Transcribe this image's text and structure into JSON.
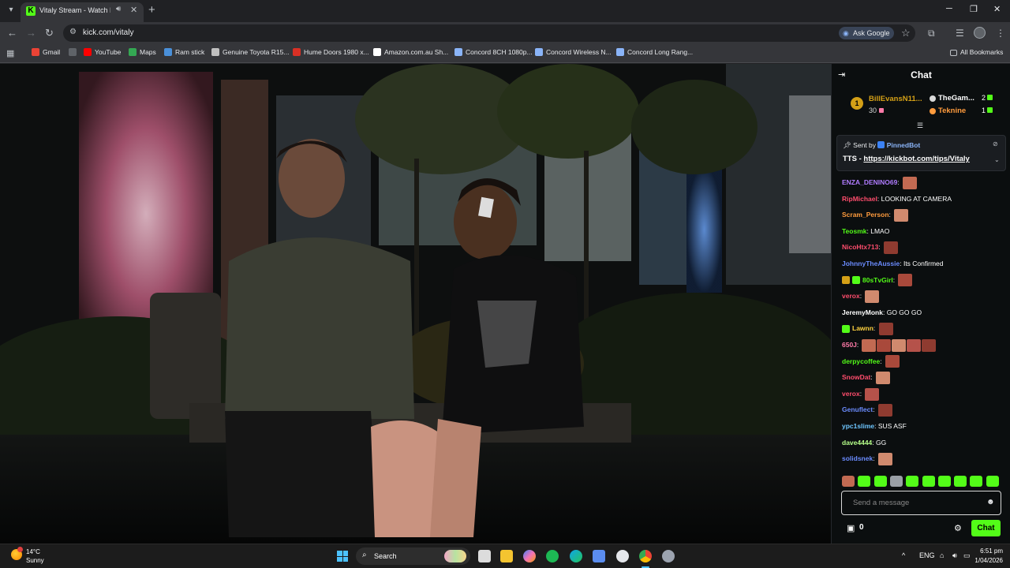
{
  "browser": {
    "tab": {
      "title": "Vitaly Stream - Watch Live o",
      "favicon": "K"
    },
    "url": "kick.com/vitaly",
    "ask_google": "Ask Google",
    "bookmarks": [
      {
        "label": "Gmail",
        "color": "#ea4335"
      },
      {
        "label": "",
        "color": "#5f6368"
      },
      {
        "label": "YouTube",
        "color": "#ff0000"
      },
      {
        "label": "Maps",
        "color": "#34a853"
      },
      {
        "label": "Ram stick",
        "color": "#4a90d9"
      },
      {
        "label": "Genuine Toyota R15...",
        "color": "#c0c0c0"
      },
      {
        "label": "Hume Doors 1980 x...",
        "color": "#d93025"
      },
      {
        "label": "Amazon.com.au Sh...",
        "color": "#ffffff"
      },
      {
        "label": "Concord 8CH 1080p...",
        "color": "#8ab4f8"
      },
      {
        "label": "Concord Wireless N...",
        "color": "#8ab4f8"
      },
      {
        "label": "Concord Long Rang...",
        "color": "#8ab4f8"
      }
    ],
    "all_bookmarks": "All Bookmarks"
  },
  "chat": {
    "title": "Chat",
    "leaderboard": [
      {
        "rank": "1",
        "name": "BillEvansN11...",
        "count": "30"
      },
      {
        "name": "TheGam...",
        "count": "2"
      },
      {
        "name": "Teknine",
        "count": "1"
      }
    ],
    "pinned": {
      "sent_by_label": "Sent by",
      "bot": "PinnedBot",
      "prefix": "TTS - ",
      "link": "https://kickbot.com/tips/Vitaly"
    },
    "messages": [
      {
        "user": "ENZA_DENINO69",
        "color": "#b07cff",
        "text": "",
        "emotes": 1
      },
      {
        "user": "RipMichael",
        "color": "#ff4d6d",
        "text": "LOOKING AT CAMERA",
        "emotes": 0
      },
      {
        "user": "Scram_Person",
        "color": "#ff9b3d",
        "text": "",
        "emotes": 1
      },
      {
        "user": "Teosmk",
        "color": "#53fc18",
        "text": "LMAO",
        "emotes": 0
      },
      {
        "user": "NicoHtx713",
        "color": "#ff4d6d",
        "text": "",
        "emotes": 1
      },
      {
        "user": "JohnnyTheAussie",
        "color": "#6b8cff",
        "text": "Its Confirmed",
        "emotes": 0
      },
      {
        "user": "80sTvGirl",
        "color": "#53fc18",
        "text": "",
        "emotes": 1,
        "badges": 2
      },
      {
        "user": "verox",
        "color": "#ff4d6d",
        "text": "",
        "emotes": 1
      },
      {
        "user": "JeremyMonk",
        "color": "#ffffff",
        "text": "GO GO GO",
        "emotes": 0
      },
      {
        "user": "Lawnn",
        "color": "#ffd23f",
        "text": "",
        "emotes": 1,
        "badges": 1
      },
      {
        "user": "650J",
        "color": "#ff7aa8",
        "text": "",
        "emotes": 5
      },
      {
        "user": "derpycoffee",
        "color": "#53fc18",
        "text": "",
        "emotes": 1
      },
      {
        "user": "SnowDat",
        "color": "#ff4d6d",
        "text": "",
        "emotes": 1
      },
      {
        "user": "verox",
        "color": "#ff4d6d",
        "text": "",
        "emotes": 1
      },
      {
        "user": "Genuflect",
        "color": "#6b8cff",
        "text": "",
        "emotes": 1
      },
      {
        "user": "ypc1slime",
        "color": "#6ec6ff",
        "text": "SUS ASF",
        "emotes": 0
      },
      {
        "user": "dave4444",
        "color": "#b6ff8a",
        "text": "GG",
        "emotes": 0
      },
      {
        "user": "solidsnek",
        "color": "#6b8cff",
        "text": "",
        "emotes": 1
      }
    ],
    "input_placeholder": "Send a message",
    "wallet_count": "0",
    "send_label": "Chat"
  },
  "taskbar": {
    "weather_temp": "14°C",
    "weather_desc": "Sunny",
    "search_label": "Search",
    "lang": "ENG",
    "time": "6:51 pm",
    "date": "1/04/2026"
  }
}
